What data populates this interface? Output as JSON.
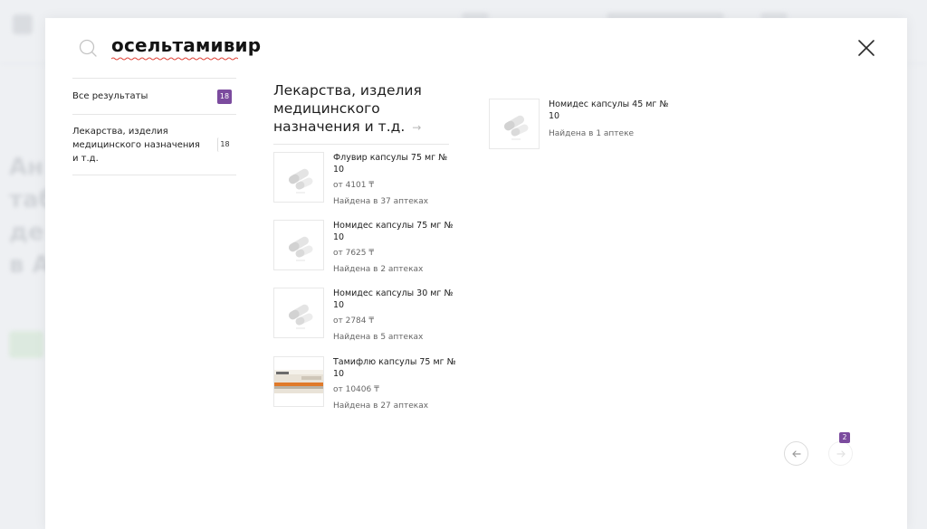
{
  "search": {
    "query": "осельтамивир"
  },
  "filters": [
    {
      "label": "Все результаты",
      "count": "18"
    },
    {
      "label": "Лекарства, изделия медицинского назначения и т.д.",
      "count": "18"
    }
  ],
  "category": {
    "title": "Лекарства, изделия медицинского назначения и т.д."
  },
  "products": [
    {
      "name": "Флувир капсулы 75 мг № 10",
      "price": "от 4101 ₸",
      "found": "Найдена в 37 аптеках",
      "image": "capsule-pills"
    },
    {
      "name": "Номидес капсулы 75 мг № 10",
      "price": "от 7625 ₸",
      "found": "Найдена в 2 аптеках",
      "image": "capsule-pills"
    },
    {
      "name": "Номидес капсулы 30 мг № 10",
      "price": "от 2784 ₸",
      "found": "Найдена в 5 аптеках",
      "image": "capsule-pills"
    },
    {
      "name": "Тамифлю капсулы 75 мг № 10",
      "price": "от 10406 ₸",
      "found": "Найдена в 27 аптеках",
      "image": "medicine-box"
    },
    {
      "name": "Номидес капсулы 45 мг № 10",
      "price": "",
      "found": "Найдена в 1 аптеке",
      "image": "capsule-pills"
    }
  ],
  "pagination": {
    "page_badge": "2"
  },
  "colors": {
    "accent": "#7b4b9e",
    "border": "#e6e6e6",
    "muted_text": "#666666"
  },
  "icons": [
    "search-icon",
    "close-icon",
    "arrow-right-icon",
    "arrow-left-icon"
  ]
}
